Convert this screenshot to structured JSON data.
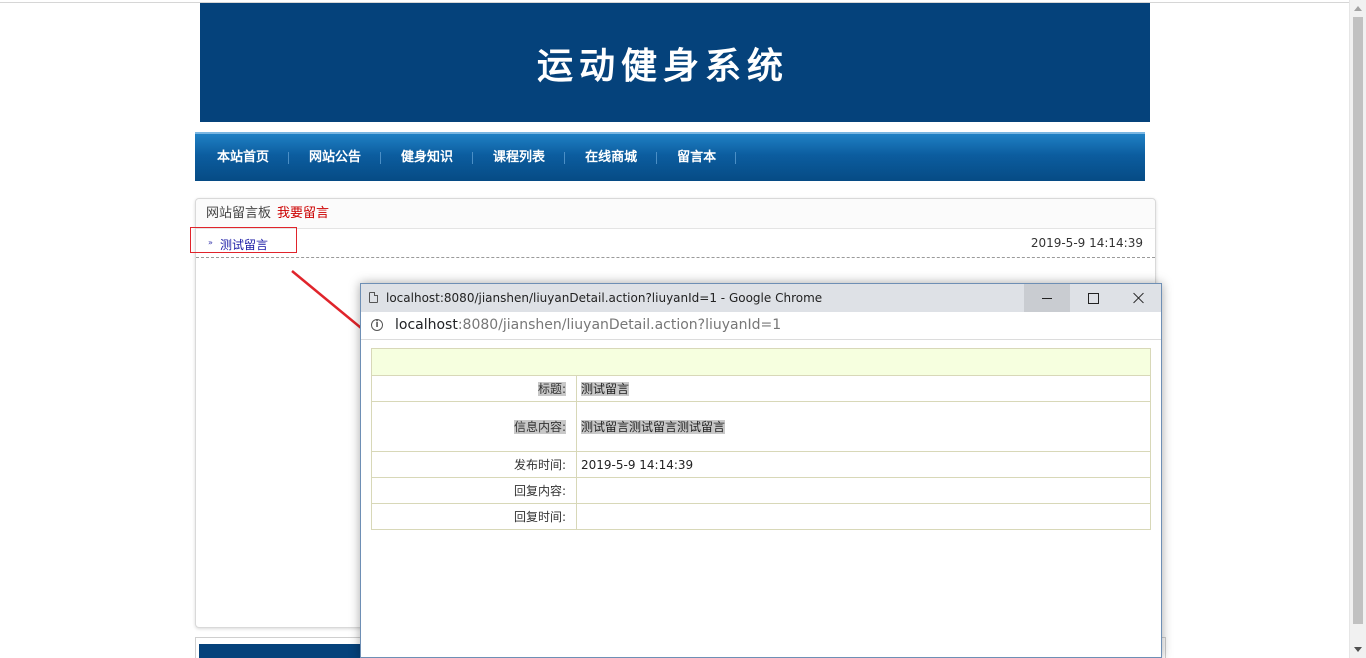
{
  "site": {
    "title": "运动健身系统"
  },
  "nav": {
    "items": [
      "本站首页",
      "网站公告",
      "健身知识",
      "课程列表",
      "在线商城",
      "留言本"
    ]
  },
  "board": {
    "title": "网站留言板",
    "post_link": "我要留言",
    "messages": [
      {
        "bullet": "»",
        "title": "测试留言",
        "time": "2019-5-9 14:14:39"
      }
    ]
  },
  "popup": {
    "window_title": "localhost:8080/jianshen/liuyanDetail.action?liuyanId=1 - Google Chrome",
    "address_host": "localhost",
    "address_path": ":8080/jianshen/liuyanDetail.action?liuyanId=1",
    "info_icon": "i",
    "detail": {
      "title_label": "标题:",
      "title_value": "测试留言",
      "content_label": "信息内容:",
      "content_value": "测试留言测试留言测试留言",
      "time_label": "发布时间:",
      "time_value": "2019-5-9 14:14:39",
      "reply_content_label": "回复内容:",
      "reply_content_value": "",
      "reply_time_label": "回复时间:",
      "reply_time_value": ""
    }
  },
  "colors": {
    "banner": "#05427b",
    "nav": "#0c5d9f",
    "annotation": "#e0242b"
  }
}
